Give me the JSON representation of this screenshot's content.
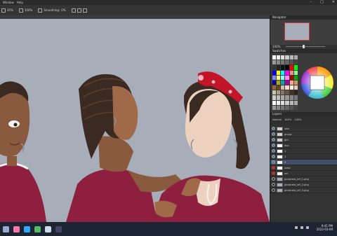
{
  "menubar": {
    "items": [
      "Window",
      "Help"
    ]
  },
  "options": {
    "zoom_a": "45%",
    "zoom_b": "100%",
    "smoothing_label": "Smoothing:",
    "smoothing_value": "0%"
  },
  "panels": {
    "navigator": "Navigator",
    "swatches": "Swatches",
    "layers": "Layers",
    "zoom_value": "100%"
  },
  "layers": {
    "blend_mode": "Normal",
    "opacity": "100%",
    "fill": "100%",
    "rows": [
      {
        "name": "skin",
        "thumb": "#cfcfcf",
        "eye": true,
        "red": false
      },
      {
        "name": "group",
        "thumb": "#cfcfcf",
        "eye": true,
        "red": false
      },
      {
        "name": "girl",
        "thumb": "#cfcfcf",
        "eye": true,
        "red": false
      },
      {
        "name": "line",
        "thumb": "#ffffff",
        "eye": true,
        "red": false
      },
      {
        "name": "1",
        "thumb": "#ffffff",
        "eye": true,
        "red": false
      },
      {
        "name": "2",
        "thumb": "#ffffff",
        "eye": true,
        "red": false
      },
      {
        "name": "3",
        "thumb": "#ffffff",
        "eye": true,
        "red": false
      },
      {
        "name": "base",
        "thumb": "#ffffff",
        "eye": true,
        "red": true
      },
      {
        "name": "ref",
        "thumb": "#ffffff",
        "eye": true,
        "red": true
      },
      {
        "name": "pinterest_ref_1.png",
        "thumb": "#aab",
        "eye": false,
        "red": false
      },
      {
        "name": "pinterest_ref_2.png",
        "thumb": "#aab",
        "eye": false,
        "red": false
      },
      {
        "name": "pinterest_ref_3.png",
        "thumb": "#aab",
        "eye": false,
        "red": false
      }
    ]
  },
  "taskbar": {
    "time": "9:41 PM",
    "date": "2022-03-09"
  },
  "colors": {
    "canvas_bg": "#a7aeb9",
    "shirt": "#8e1f3f",
    "skin_dark": "#8a5a3e",
    "skin_mid": "#a06a48",
    "skin_light": "#ecd2be",
    "hair": "#3b2a22",
    "bandana": "#c4142a"
  }
}
